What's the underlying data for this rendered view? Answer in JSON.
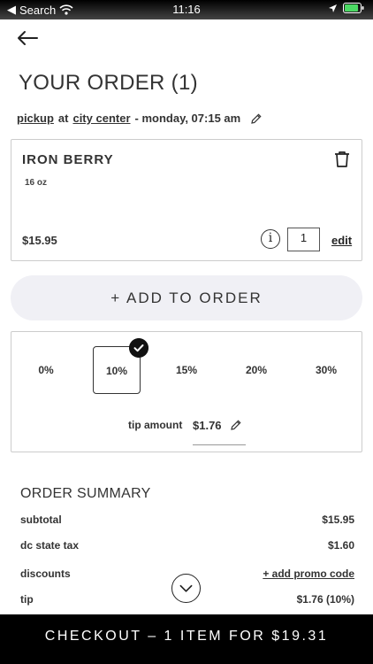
{
  "status_bar": {
    "back_app": "Search",
    "time": "11:16"
  },
  "header": {
    "title": "YOUR ORDER (1)"
  },
  "order_meta": {
    "mode": "pickup",
    "at": "at",
    "location": "city center",
    "when": "- monday, 07:15 am"
  },
  "item": {
    "name": "IRON BERRY",
    "size": "16 oz",
    "price": "$15.95",
    "info": "i",
    "quantity": "1",
    "edit_label": "edit"
  },
  "add_to_order": {
    "label": "+ ADD TO ORDER"
  },
  "tip": {
    "options": [
      "0%",
      "10%",
      "15%",
      "20%",
      "30%"
    ],
    "selected": "10%",
    "amount_label": "tip amount",
    "amount": "$1.76"
  },
  "summary": {
    "title": "ORDER SUMMARY",
    "rows": [
      {
        "label": "subtotal",
        "value": "$15.95"
      },
      {
        "label": "dc state tax",
        "value": "$1.60"
      },
      {
        "label": "discounts",
        "value": "+ add promo code"
      },
      {
        "label": "tip",
        "value": "$1.76 (10%)"
      }
    ]
  },
  "checkout": {
    "label": "CHECKOUT – 1 ITEM FOR $19.31"
  }
}
